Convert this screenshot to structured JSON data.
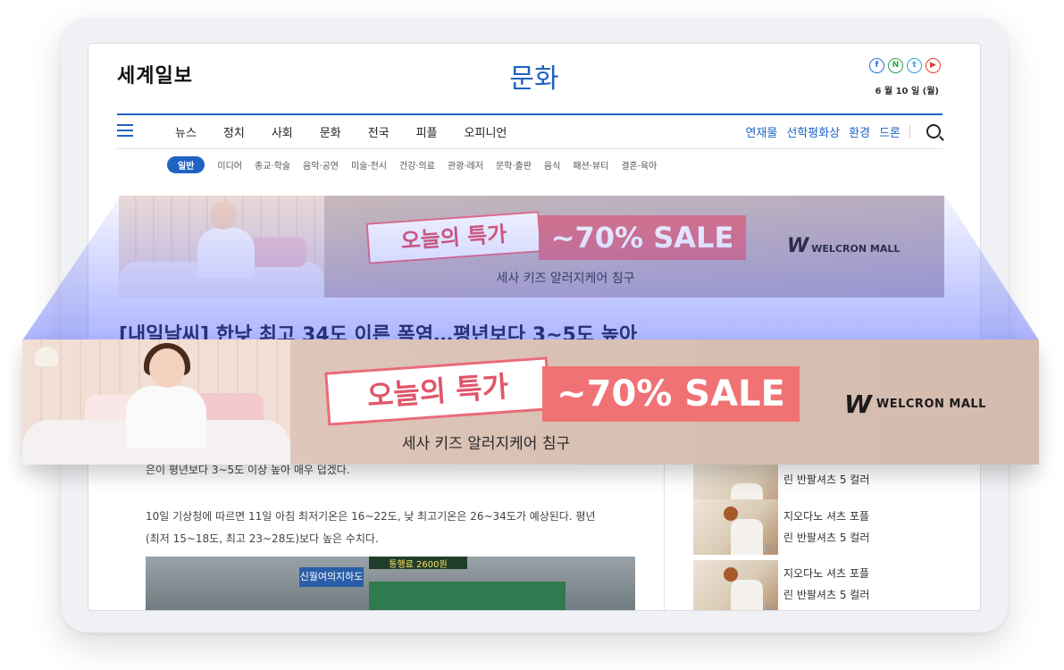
{
  "header": {
    "logo": "세계일보",
    "section_title": "문화",
    "date": "6 월 10 일 (월)",
    "social": [
      "f",
      "N",
      "t",
      "▶"
    ]
  },
  "nav": {
    "main": [
      "뉴스",
      "정치",
      "사회",
      "문화",
      "전국",
      "피플",
      "오피니언"
    ],
    "right": [
      "연재물",
      "선학평화상",
      "환경",
      "드론"
    ]
  },
  "subnav": {
    "active": "일반",
    "items": [
      "미디어",
      "종교·학술",
      "음악·공연",
      "미술·전시",
      "건강·의료",
      "관광·레저",
      "문학·출판",
      "음식",
      "패션·뷰티",
      "결혼·육아"
    ]
  },
  "banner": {
    "tag": "오늘의 특가",
    "sale": "~70% SALE",
    "subtitle": "세사 키즈 알러지케어 침구",
    "brand": "WELCRON MALL",
    "colors": {
      "sale_bg": "#f07275",
      "tag_border": "#e86b79",
      "bg": "#d9c3b6"
    }
  },
  "article": {
    "headline": "[내일날씨] 한낮 최고 34도 이른 폭염…평년보다 3~5도 높아",
    "partial_line": "은이 평년보다 3~5도 이상 높아 매우 덥겠다.",
    "para1_line1": "10일 기상청에 따르면 11일 아침 최저기온은 16~22도, 낮 최고기온은 26~34도가 예상된다. 평년",
    "para1_line2": "(최저 15~18도, 최고 23~28도)보다 높은 수치다.",
    "photo_sign1": "신월여의지하도",
    "photo_sign2": "통행료 2600원"
  },
  "side_ads": [
    {
      "line1": "",
      "line2": "린 반팔셔츠 5 컬러"
    },
    {
      "line1": "지오다노 셔츠 포플",
      "line2": "린 반팔셔츠 5 컬러"
    },
    {
      "line1": "지오다노 셔츠 포플",
      "line2": "린 반팔셔츠 5 컬러"
    }
  ]
}
